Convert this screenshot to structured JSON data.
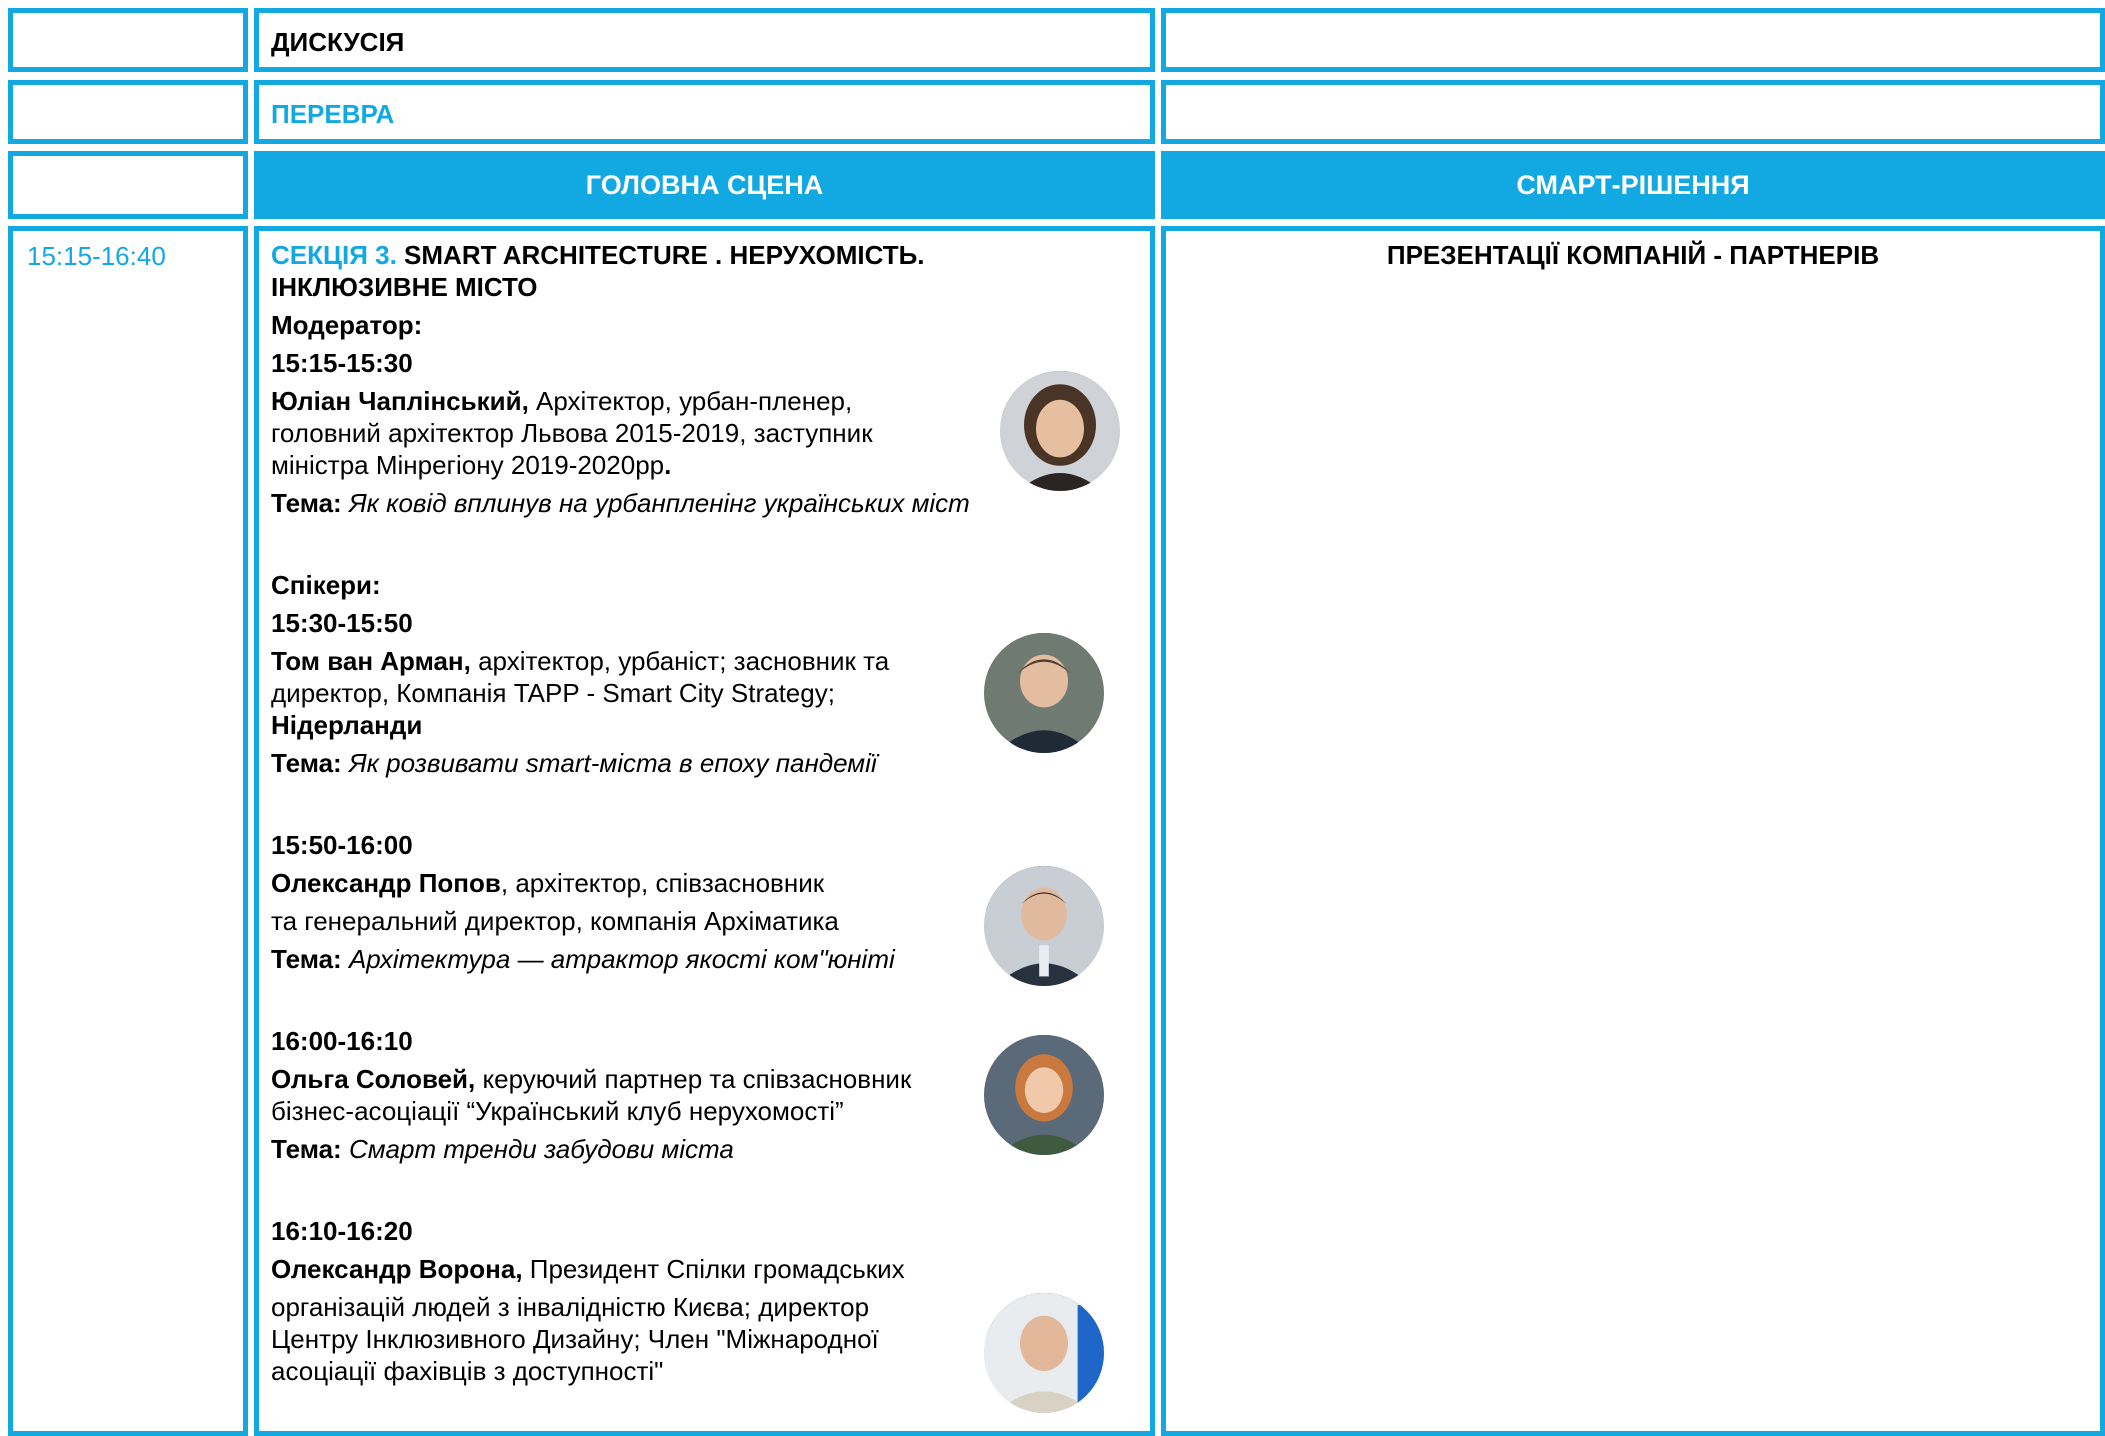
{
  "rows": {
    "discussion": {
      "label": "ДИСКУСІЯ"
    },
    "break": {
      "label": "ПЕРЕВРА"
    }
  },
  "headers": {
    "main_stage": "ГОЛОВНА СЦЕНА",
    "smart_solutions": "СМАРТ-РІШЕННЯ"
  },
  "session": {
    "time": "15:15-16:40",
    "title_prefix": "СЕКЦІЯ 3.",
    "title": " SMART ARCHITECTURE . НЕРУХОМІСТЬ. ІНКЛЮЗИВНЕ МІСТО",
    "moderator_label": "Модератор:",
    "speakers_label": "Спікери:",
    "topic_label": "Тема:",
    "entries": [
      {
        "time": "15:15-15:30",
        "name": "Юліан Чаплінський,",
        "role": " Архітектор, урбан-пленер, головний архітектор  Львова 2015-2019, заступник міністра Мінрегіону 2019-2020рр",
        "role_end": ".",
        "topic": " Як ковід вплинув на урбанпленінг українських міст"
      },
      {
        "time": "15:30-15:50",
        "name": "Том ван Арман,",
        "role": " архітектор, урбаніст; засновник та директор, Компанія TAPP - Smart City Strategy;",
        "country": "Нідерланди",
        "topic": " Як розвивати smart-міста в епоху пандемії"
      },
      {
        "time": "15:50-16:00",
        "name": "Олександр Попов",
        "role": ", архітектор, співзасновник",
        "role2": "та генеральний директор, компанія Архіматика",
        "topic": " Архітектура — атрактор якості ком\"юніті"
      },
      {
        "time": "16:00-16:10",
        "name": "Ольга Соловей,",
        "role": " керуючий партнер та співзасновник бізнес-асоціації “Український клуб нерухомості”",
        "topic": " Смарт тренди забудови міста"
      },
      {
        "time": "16:10-16:20",
        "name": "Олександр Ворона,",
        "role": " Президент Спілки громадських",
        "role2": "організацій людей з інвалідністю Києва; директор Центру Інклюзивного Дизайну; Член \"Міжнародної асоціації фахівців з доступності\""
      }
    ],
    "partners_title": "ПРЕЗЕНТАЦІЇ КОМПАНІЙ - ПАРТНЕРІВ"
  },
  "colors": {
    "accent": "#12a9e2",
    "text": "#000000",
    "background": "#ffffff"
  },
  "icons": [
    "speaker-photo"
  ]
}
